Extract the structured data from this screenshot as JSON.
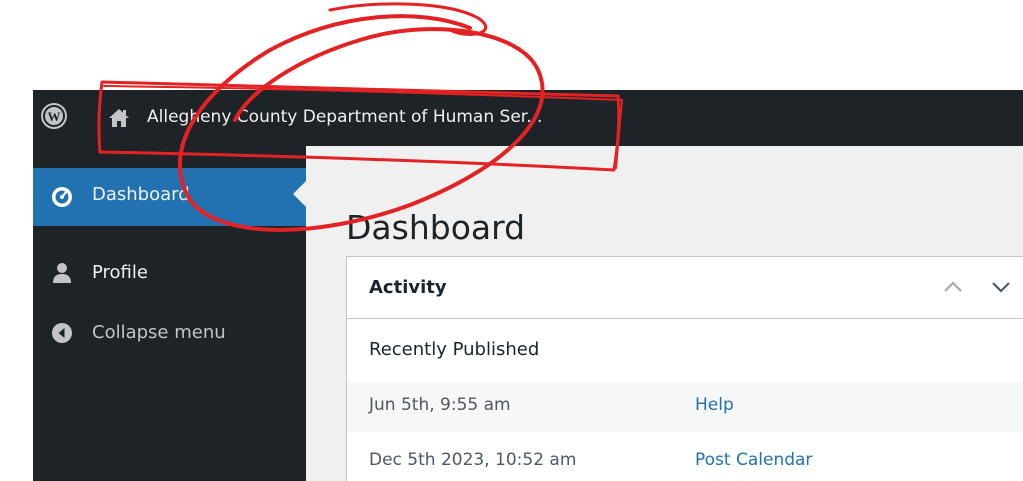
{
  "colors": {
    "admin_bar_bg": "#1d2327",
    "sidebar_bg": "#1d2327",
    "active_menu_bg": "#2271b1",
    "link_color": "#2271b1",
    "main_bg": "#f0f0f1",
    "annotation_red": "#e32224"
  },
  "admin_bar": {
    "logo_icon": "wordpress-logo-icon",
    "home_icon": "home-icon",
    "site_name": "Allegheny County Department of Human Ser..."
  },
  "sidebar": {
    "items": [
      {
        "label": "Dashboard",
        "icon": "dashboard-gauge-icon",
        "active": true
      },
      {
        "label": "Profile",
        "icon": "user-icon",
        "active": false
      },
      {
        "label": "Collapse menu",
        "icon": "collapse-arrow-icon",
        "active": false
      }
    ]
  },
  "main": {
    "page_title": "Dashboard",
    "activity": {
      "title": "Activity",
      "move_up_icon": "chevron-up-icon",
      "move_down_icon": "chevron-down-icon",
      "section_heading": "Recently Published",
      "rows": [
        {
          "date": "Jun 5th, 9:55 am",
          "title": "Help"
        },
        {
          "date": "Dec 5th 2023, 10:52 am",
          "title": "Post Calendar"
        }
      ]
    }
  }
}
